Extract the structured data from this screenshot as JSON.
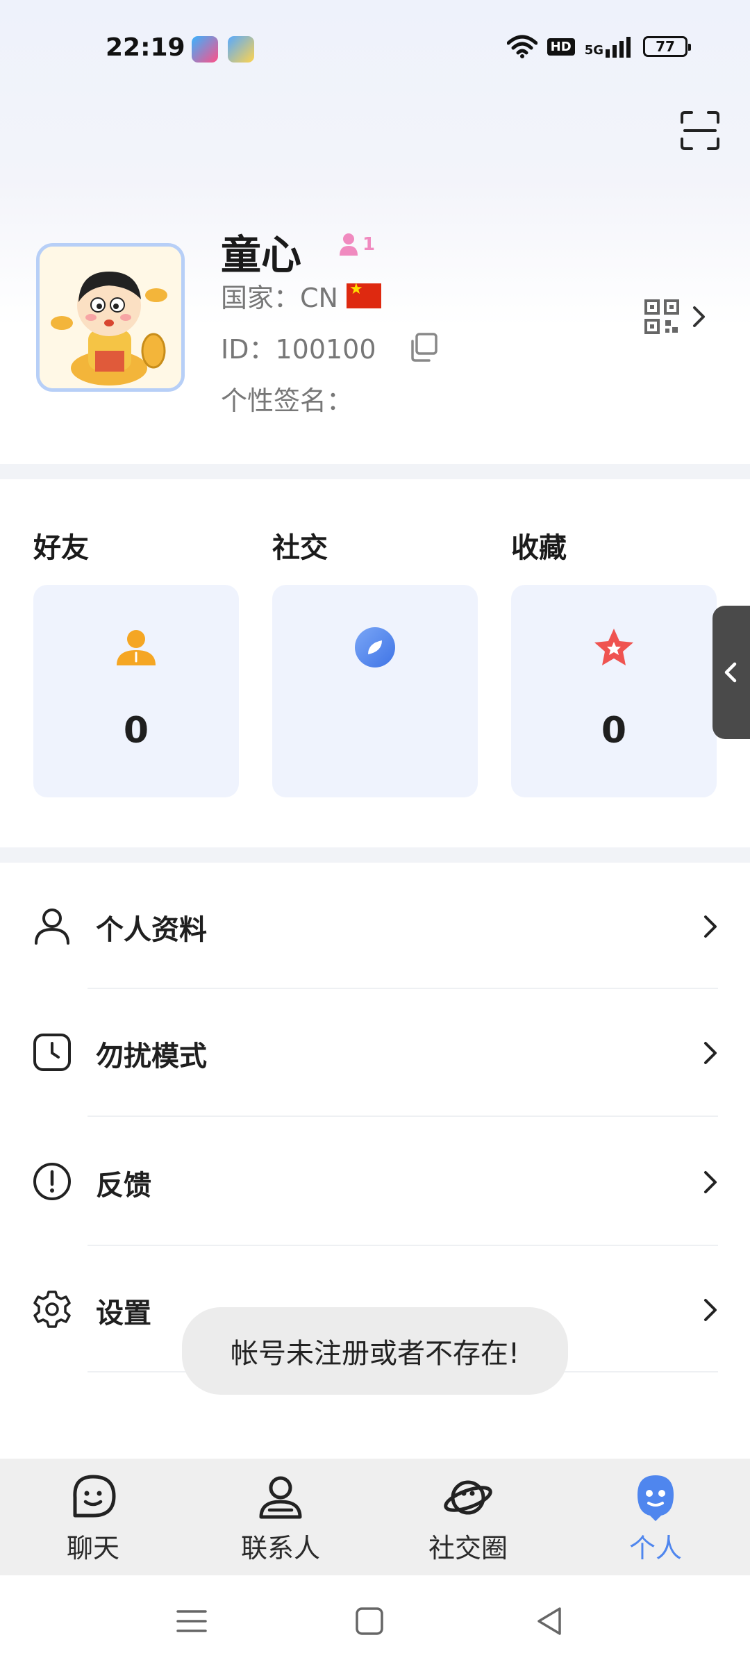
{
  "status_bar": {
    "time": "22:19",
    "network": "5G",
    "hd": "HD",
    "battery": "77"
  },
  "profile": {
    "name": "童心",
    "friend_count": "1",
    "country": "国家：CN",
    "id": "ID：100100",
    "signature": "个性签名："
  },
  "stats": [
    {
      "title": "好友",
      "value": "0",
      "icon": "friend-person-icon"
    },
    {
      "title": "社交",
      "value": "",
      "icon": "social-compass-icon"
    },
    {
      "title": "收藏",
      "value": "0",
      "icon": "favorite-star-icon"
    }
  ],
  "menu": [
    {
      "label": "个人资料",
      "icon": "user-outline-icon"
    },
    {
      "label": "勿扰模式",
      "icon": "clock-icon"
    },
    {
      "label": "反馈",
      "icon": "exclamation-circle-icon"
    },
    {
      "label": "设置",
      "icon": "gear-icon"
    }
  ],
  "toast": "帐号未注册或者不存在!",
  "bottom_nav": [
    {
      "label": "聊天",
      "icon": "chat-smile-icon",
      "active": false
    },
    {
      "label": "联系人",
      "icon": "contacts-icon",
      "active": false
    },
    {
      "label": "社交圈",
      "icon": "planet-icon",
      "active": false
    },
    {
      "label": "个人",
      "icon": "profile-face-icon",
      "active": true
    }
  ],
  "colors": {
    "accent": "#4f86ee",
    "card_bg": "#eff3fd",
    "friend_badge": "#f08abf",
    "nav_bg": "#efefef"
  }
}
